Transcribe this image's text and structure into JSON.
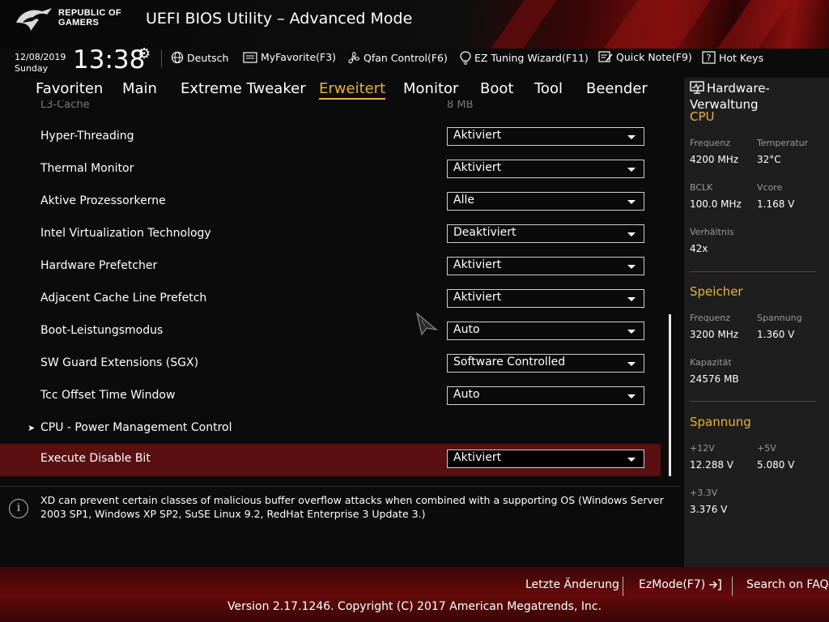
{
  "header": {
    "brand_line1": "REPUBLIC OF",
    "brand_line2": "GAMERS",
    "title": "UEFI BIOS Utility – Advanced Mode"
  },
  "infobar": {
    "date": "12/08/2019",
    "day": "Sunday",
    "time": "13:38",
    "language": "Deutsch",
    "myfavorite": "MyFavorite(F3)",
    "qfan": "Qfan Control(F6)",
    "ez_tuning": "EZ Tuning Wizard(F11)",
    "quick_note": "Quick Note(F9)",
    "hot_keys": "Hot Keys"
  },
  "tabs": [
    "Favoriten",
    "Main",
    "Extreme Tweaker",
    "Erweitert",
    "Monitor",
    "Boot",
    "Tool",
    "Beender"
  ],
  "active_tab": "Erweitert",
  "settings": {
    "l3_label": "L3-Cache",
    "l3_value": "8 MB",
    "rows": [
      {
        "label": "Hyper-Threading",
        "value": "Aktiviert"
      },
      {
        "label": "Thermal Monitor",
        "value": "Aktiviert"
      },
      {
        "label": "Aktive Prozessorkerne",
        "value": "Alle"
      },
      {
        "label": "Intel Virtualization Technology",
        "value": "Deaktiviert"
      },
      {
        "label": "Hardware Prefetcher",
        "value": "Aktiviert"
      },
      {
        "label": "Adjacent Cache Line Prefetch",
        "value": "Aktiviert"
      },
      {
        "label": "Boot-Leistungsmodus",
        "value": "Auto"
      },
      {
        "label": "SW Guard Extensions (SGX)",
        "value": "Software Controlled"
      },
      {
        "label": "Tcc Offset Time Window",
        "value": "Auto"
      }
    ],
    "submenu": "CPU - Power Management Control",
    "selected": {
      "label": "Execute Disable Bit",
      "value": "Aktiviert"
    }
  },
  "help_text": "XD can prevent certain classes of malicious buffer overflow attacks when combined with a supporting OS (Windows Server 2003 SP1, Windows XP SP2, SuSE Linux 9.2, RedHat Enterprise 3 Update 3.)",
  "hw_monitor": {
    "title": "Hardware-Verwaltung",
    "cpu": {
      "heading": "CPU",
      "freq_label": "Frequenz",
      "freq": "4200 MHz",
      "temp_label": "Temperatur",
      "temp": "32°C",
      "bclk_label": "BCLK",
      "bclk": "100.0 MHz",
      "vcore_label": "Vcore",
      "vcore": "1.168 V",
      "ratio_label": "Verhältnis",
      "ratio": "42x"
    },
    "memory": {
      "heading": "Speicher",
      "freq_label": "Frequenz",
      "freq": "3200 MHz",
      "volt_label": "Spannung",
      "volt": "1.360 V",
      "cap_label": "Kapazität",
      "cap": "24576 MB"
    },
    "voltage": {
      "heading": "Spannung",
      "v12_label": "+12V",
      "v12": "12.288 V",
      "v5_label": "+5V",
      "v5": "5.080 V",
      "v33_label": "+3.3V",
      "v33": "3.376 V"
    }
  },
  "footer": {
    "last_change": "Letzte Änderung",
    "ezmode": "EzMode(F7)",
    "faq": "Search on FAQ",
    "copyright": "Version 2.17.1246. Copyright (C) 2017 American Megatrends, Inc."
  },
  "colors": {
    "accent": "#e7b23a",
    "selected_row": "#5a1010",
    "footer": "#650a0a"
  }
}
